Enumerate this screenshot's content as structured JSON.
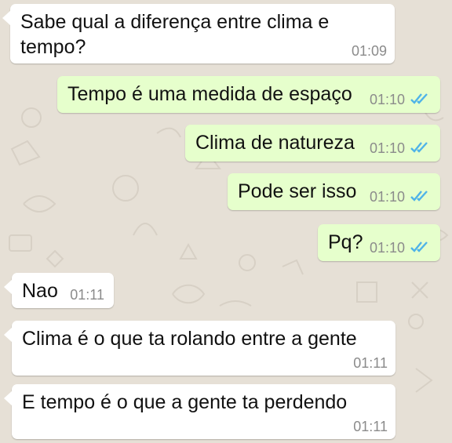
{
  "colors": {
    "incoming_bubble": "#ffffff",
    "outgoing_bubble": "#e6ffcc",
    "timestamp": "#8b8b8b",
    "read_ticks": "#4fb3e8"
  },
  "messages": [
    {
      "direction": "incoming",
      "text_lines": [
        "Sabe qual a diferença entre clima e",
        "tempo?"
      ],
      "time": "01:09"
    },
    {
      "direction": "outgoing",
      "text": "Tempo é uma medida de espaço",
      "time": "01:10",
      "status_icon": "double-check-read-icon"
    },
    {
      "direction": "outgoing",
      "text": "Clima de natureza",
      "time": "01:10",
      "status_icon": "double-check-read-icon"
    },
    {
      "direction": "outgoing",
      "text": "Pode ser isso",
      "time": "01:10",
      "status_icon": "double-check-read-icon"
    },
    {
      "direction": "outgoing",
      "text": "Pq?",
      "time": "01:10",
      "status_icon": "double-check-read-icon"
    },
    {
      "direction": "incoming",
      "text": "Nao",
      "time": "01:11"
    },
    {
      "direction": "incoming",
      "text": "Clima é o que ta rolando entre a gente",
      "time": "01:11"
    },
    {
      "direction": "incoming",
      "text": "E tempo é o que a gente ta perdendo",
      "time": "01:11"
    }
  ]
}
